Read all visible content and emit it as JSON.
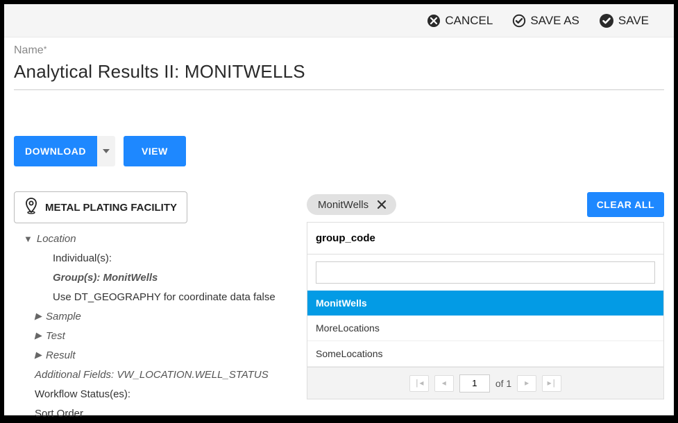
{
  "topbar": {
    "cancel": "CANCEL",
    "save_as": "SAVE AS",
    "save": "SAVE"
  },
  "name": {
    "label": "Name",
    "required_marker": "*",
    "value": "Analytical Results II: MONITWELLS"
  },
  "actions": {
    "download": "DOWNLOAD",
    "view": "VIEW"
  },
  "facility": {
    "label": "METAL PLATING FACILITY"
  },
  "tree": {
    "location_label": "Location",
    "individuals": "Individual(s):",
    "groups": "Group(s): MonitWells",
    "geography": "Use DT_GEOGRAPHY for coordinate data false",
    "sample": "Sample",
    "test": "Test",
    "result": "Result",
    "additional_fields": "Additional Fields: VW_LOCATION.WELL_STATUS",
    "workflow_statuses": "Workflow Status(es):",
    "sort_order": "Sort Order"
  },
  "chip": {
    "label": "MonitWells"
  },
  "clear_all": "CLEAR ALL",
  "panel": {
    "header": "group_code",
    "search_value": "",
    "search_placeholder": "",
    "items": [
      {
        "label": "MonitWells",
        "selected": true
      },
      {
        "label": "MoreLocations",
        "selected": false
      },
      {
        "label": "SomeLocations",
        "selected": false
      }
    ]
  },
  "pager": {
    "current": "1",
    "of_label": "of",
    "total": "1"
  }
}
